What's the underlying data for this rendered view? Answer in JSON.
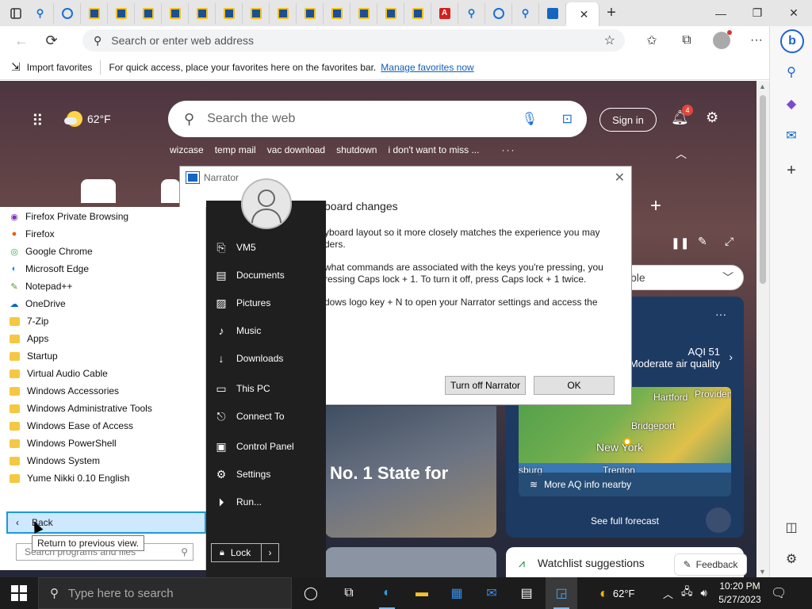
{
  "browser": {
    "tabs": [
      "search",
      "speedtest",
      "vm",
      "vm",
      "vm",
      "vm",
      "vm",
      "vm",
      "vm",
      "vm",
      "vm",
      "vm",
      "vm",
      "vm",
      "vm",
      "adobe",
      "search",
      "speedtest",
      "search",
      "narrator",
      "active"
    ],
    "tab_close": "✕",
    "new_tab": "+",
    "window_controls": {
      "minimize": "—",
      "restore": "❐",
      "close": "✕"
    },
    "address_placeholder": "Search or enter web address",
    "favbar_import": "Import favorites",
    "favbar_text": "For quick access, place your favorites here on the favorites bar.",
    "favbar_link": "Manage favorites now"
  },
  "msn": {
    "temperature": "62°F",
    "search_placeholder": "Search the web",
    "sign_in": "Sign in",
    "notification_count": "4",
    "trending": [
      "wizcase",
      "temp mail",
      "vac download",
      "shutdown",
      "i don't want to miss ..."
    ],
    "trending_more": "···",
    "dropdown_text": "ble",
    "aqi_value": "AQI 51",
    "aqi_label": "Moderate air quality",
    "map_cities": {
      "hartford": "Hartford",
      "providence": "Providen",
      "bridgeport": "Bridgeport",
      "newyork": "New York",
      "trenton": "Trenton",
      "sburg": "sburg"
    },
    "map_footer": "More AQ info nearby",
    "full_forecast": "See full forecast",
    "news_headline": "No. 1 State for",
    "watchlist": "Watchlist suggestions",
    "feedback": "Feedback"
  },
  "narrator": {
    "title": "Narrator",
    "heading": "board changes",
    "para1": "yboard layout so it more closely matches the experience you may\nders.",
    "para2": "what commands are associated with the keys you're pressing, you\nressing Caps lock + 1. To turn it off, press Caps lock + 1 twice.",
    "para3": "dows logo key + N to open your Narrator settings and access the",
    "turn_off": "Turn off Narrator",
    "ok": "OK"
  },
  "start_menu": {
    "programs": [
      {
        "label": "Firefox Private Browsing",
        "icon": "firefox-private"
      },
      {
        "label": "Firefox",
        "icon": "firefox"
      },
      {
        "label": "Google Chrome",
        "icon": "chrome"
      },
      {
        "label": "Microsoft Edge",
        "icon": "edge"
      },
      {
        "label": "Notepad++",
        "icon": "notepadpp"
      },
      {
        "label": "OneDrive",
        "icon": "onedrive"
      },
      {
        "label": "7-Zip",
        "icon": "folder"
      },
      {
        "label": "Apps",
        "icon": "folder"
      },
      {
        "label": "Startup",
        "icon": "folder"
      },
      {
        "label": "Virtual Audio Cable",
        "icon": "folder"
      },
      {
        "label": "Windows Accessories",
        "icon": "folder"
      },
      {
        "label": "Windows Administrative Tools",
        "icon": "folder"
      },
      {
        "label": "Windows Ease of Access",
        "icon": "folder"
      },
      {
        "label": "Windows PowerShell",
        "icon": "folder"
      },
      {
        "label": "Windows System",
        "icon": "folder"
      },
      {
        "label": "Yume Nikki 0.10 English",
        "icon": "folder"
      }
    ],
    "back": "Back",
    "tooltip": "Return to previous view.",
    "search_placeholder": "Search programs and files",
    "places": [
      "VM5",
      "Documents",
      "Pictures",
      "Music",
      "Downloads",
      "This PC",
      "Connect To",
      "Control Panel",
      "Settings",
      "Run..."
    ],
    "lock": "Lock"
  },
  "taskbar": {
    "search_placeholder": "Type here to search",
    "temperature": "62°F",
    "time": "10:20 PM",
    "date": "5/27/2023"
  }
}
